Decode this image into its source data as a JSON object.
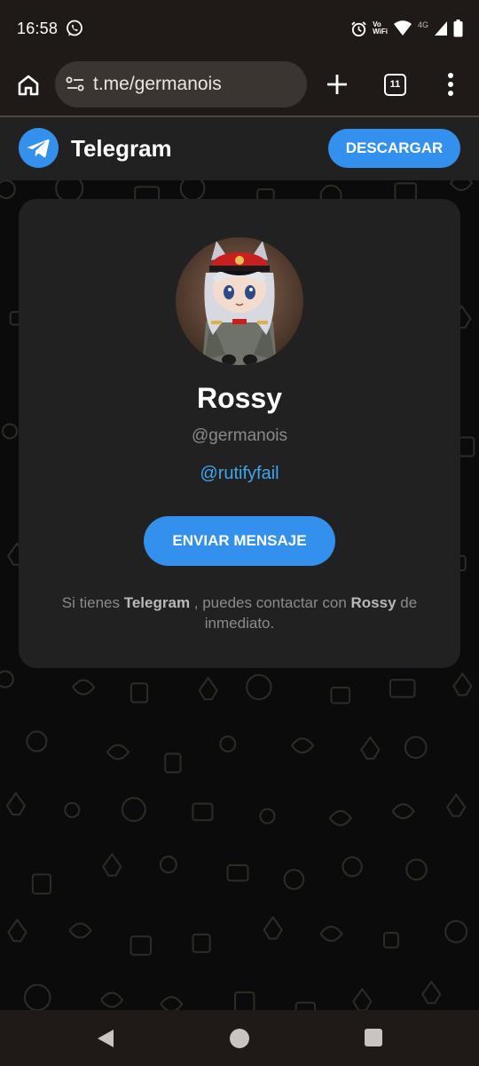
{
  "status_bar": {
    "time": "16:58",
    "vowifi_line1": "Vo",
    "vowifi_line2": "WiFi",
    "network": "4G",
    "icons": [
      "whatsapp-icon",
      "alarm-icon",
      "wifi-icon",
      "signal-icon",
      "battery-icon"
    ]
  },
  "browser": {
    "url": "t.me/germanois",
    "tab_count": "11",
    "icons": [
      "home-icon",
      "site-settings-icon",
      "new-tab-icon",
      "tab-switcher-icon",
      "overflow-menu-icon"
    ]
  },
  "header": {
    "app_name": "Telegram",
    "download_label": "DESCARGAR"
  },
  "profile": {
    "name": "Rossy",
    "username": "@germanois",
    "bio_link": "@rutifyfail",
    "send_label": "ENVIAR MENSAJE",
    "info_prefix": "Si tienes ",
    "info_app": "Telegram",
    "info_middle": " , puedes contactar con ",
    "info_name": "Rossy",
    "info_suffix": " de inmediato."
  },
  "nav_bar": {
    "icons": [
      "back-icon",
      "home-circle-icon",
      "recents-icon"
    ]
  },
  "colors": {
    "accent": "#3390ec",
    "link": "#3ea6f0",
    "card": "#212121",
    "chrome": "#1f1a17"
  }
}
